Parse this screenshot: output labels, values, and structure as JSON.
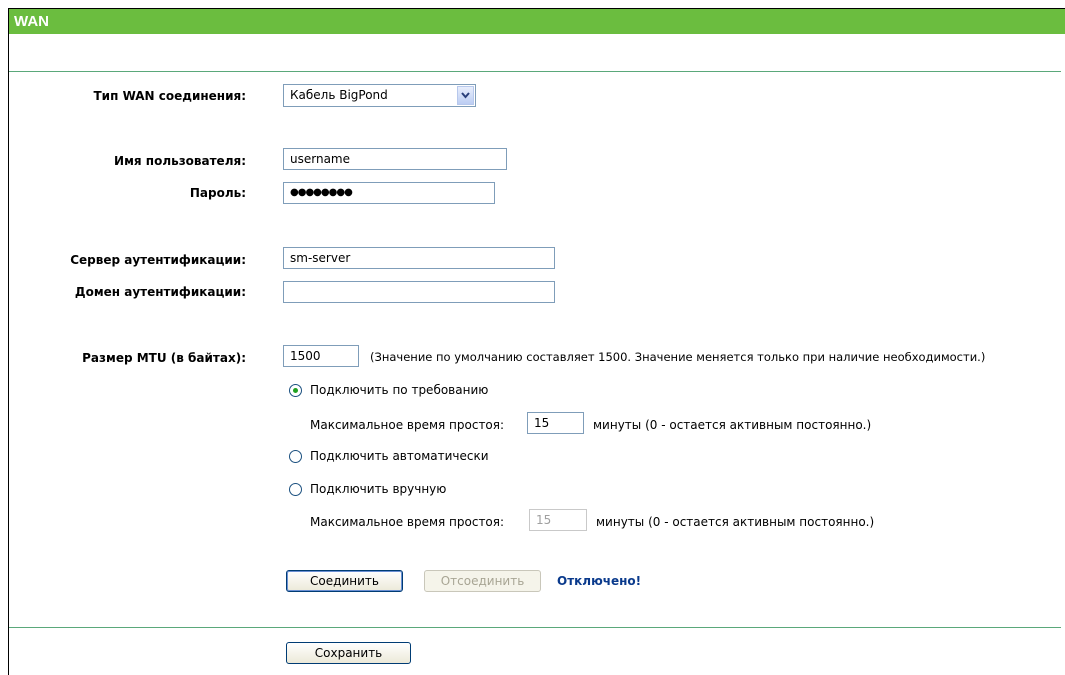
{
  "header": {
    "title": "WAN"
  },
  "form": {
    "wan_type": {
      "label": "Тип WAN соединения:",
      "value": "Кабель BigPond"
    },
    "username": {
      "label": "Имя пользователя:",
      "value": "username"
    },
    "password": {
      "label": "Пароль:",
      "value": "●●●●●●●●"
    },
    "auth_server": {
      "label": "Сервер аутентификации:",
      "value": "sm-server"
    },
    "auth_domain": {
      "label": "Домен аутентификации:",
      "value": ""
    },
    "mtu": {
      "label": "Размер MTU (в байтах):",
      "value": "1500",
      "hint": "(Значение по умолчанию составляет 1500. Значение меняется только при наличие необходимости.)"
    },
    "connect_modes": [
      {
        "label": "Подключить по требованию",
        "selected": true
      },
      {
        "label": "Подключить автоматически",
        "selected": false
      },
      {
        "label": "Подключить вручную",
        "selected": false
      }
    ],
    "idle_on_demand": {
      "label": "Максимальное время простоя:",
      "value": "15",
      "suffix": "минуты (0 - остается активным постоянно.)"
    },
    "idle_manual": {
      "label": "Максимальное время простоя:",
      "value": "15",
      "suffix": "минуты (0 - остается активным постоянно.)"
    }
  },
  "actions": {
    "connect_label": "Соединить",
    "disconnect_label": "Отсоединить",
    "status": "Отключено!",
    "save_label": "Сохранить"
  },
  "colors": {
    "header": "#6bbd3f",
    "rule": "#5aa87a",
    "status": "#0a3a8c",
    "radio_dot": "#21a121"
  }
}
